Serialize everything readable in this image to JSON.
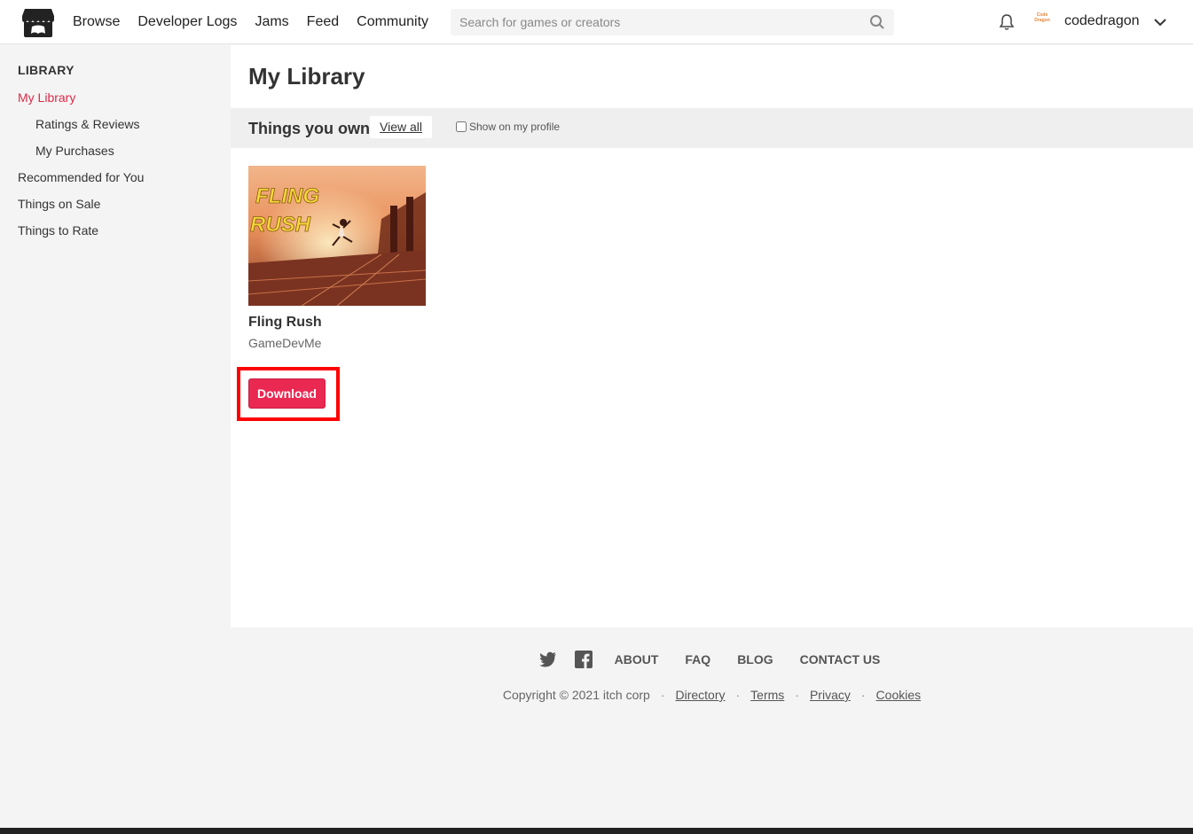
{
  "header": {
    "nav": [
      "Browse",
      "Developer Logs",
      "Jams",
      "Feed",
      "Community"
    ],
    "search_placeholder": "Search for games or creators",
    "avatar_text": "Code Dragon",
    "username": "codedragon"
  },
  "sidebar": {
    "heading": "LIBRARY",
    "items": [
      {
        "label": "My Library"
      },
      {
        "label": "Ratings & Reviews"
      },
      {
        "label": "My Purchases"
      },
      {
        "label": "Recommended for You"
      },
      {
        "label": "Things on Sale"
      },
      {
        "label": "Things to Rate"
      }
    ]
  },
  "main": {
    "title": "My Library",
    "section_title": "Things you own",
    "view_all": "View all",
    "show_profile": "Show on my profile",
    "game": {
      "cover_text_1": "FLING",
      "cover_text_2": "RUSH",
      "title": "Fling Rush",
      "author": "GameDevMe",
      "button": "Download"
    }
  },
  "footer": {
    "links": [
      "ABOUT",
      "FAQ",
      "BLOG",
      "CONTACT US"
    ],
    "copyright": "Copyright © 2021 itch corp",
    "legal": [
      "Directory",
      "Terms",
      "Privacy",
      "Cookies"
    ]
  },
  "colors": {
    "accent": "#da2c49",
    "download": "#ea2952",
    "highlight": "#ff0000"
  }
}
